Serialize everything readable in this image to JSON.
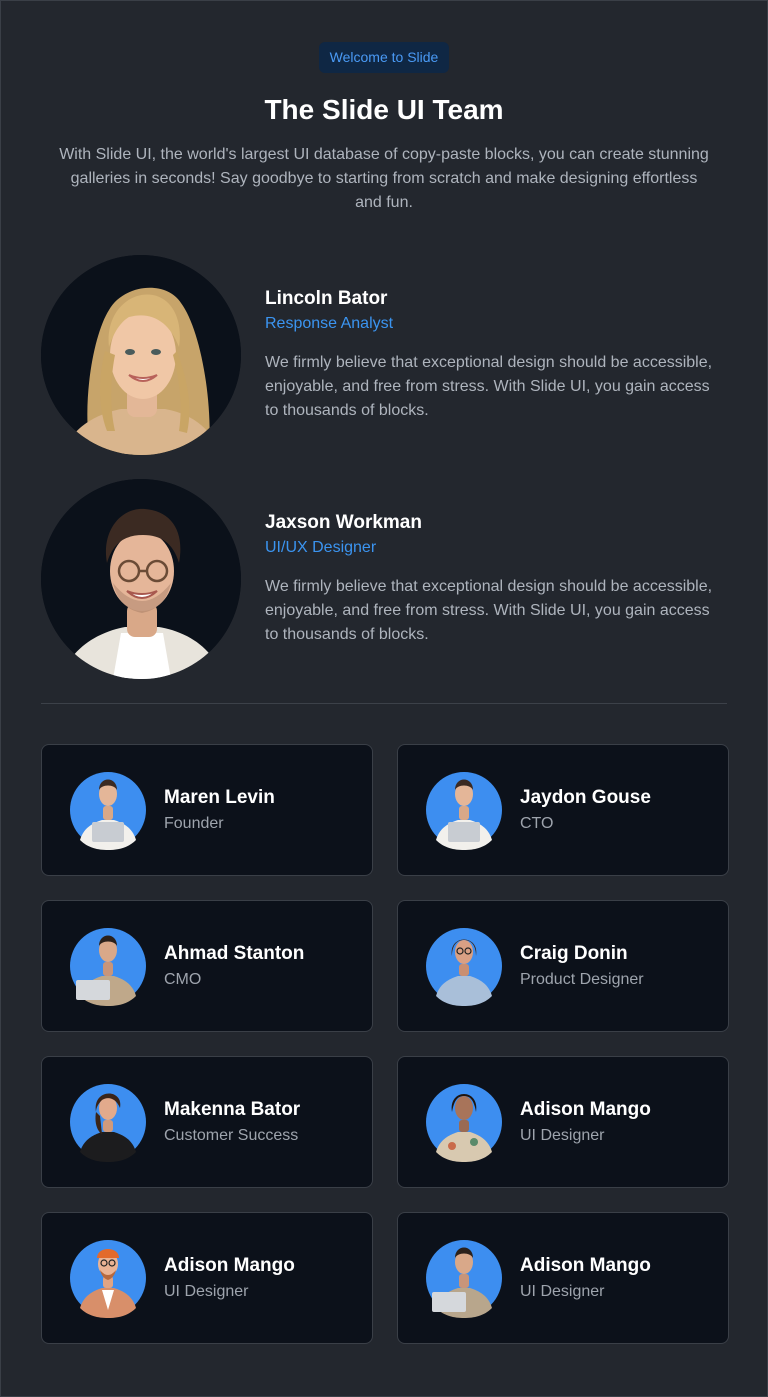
{
  "header": {
    "badge": "Welcome to Slide",
    "title": "The Slide UI Team",
    "description": "With Slide UI, the world's largest UI database of copy-paste blocks, you can create stunning galleries in seconds! Say goodbye to starting from scratch and make designing effortless and fun."
  },
  "featured": [
    {
      "name": "Lincoln Bator",
      "role": "Response Analyst",
      "bio": "We firmly believe that exceptional design should be accessible, enjoyable, and free from stress. With Slide UI, you gain access to thousands of blocks.",
      "avatar": "woman-portrait"
    },
    {
      "name": "Jaxson Workman",
      "role": "UI/UX Designer",
      "bio": "We firmly believe that exceptional design should be accessible, enjoyable, and free from stress. With Slide UI, you gain access to thousands of blocks.",
      "avatar": "man-portrait"
    }
  ],
  "team": [
    {
      "name": "Maren Levin",
      "role": "Founder"
    },
    {
      "name": "Jaydon Gouse",
      "role": "CTO"
    },
    {
      "name": "Ahmad Stanton",
      "role": "CMO"
    },
    {
      "name": "Craig Donin",
      "role": "Product Designer"
    },
    {
      "name": "Makenna Bator",
      "role": "Customer Success"
    },
    {
      "name": "Adison Mango",
      "role": "UI Designer"
    },
    {
      "name": "Adison Mango",
      "role": "UI Designer"
    },
    {
      "name": "Adison Mango",
      "role": "UI Designer"
    }
  ],
  "colors": {
    "background": "#23272e",
    "card": "#0c111a",
    "accent": "#3b94f0",
    "avatar_circle": "#3d8ef0"
  }
}
